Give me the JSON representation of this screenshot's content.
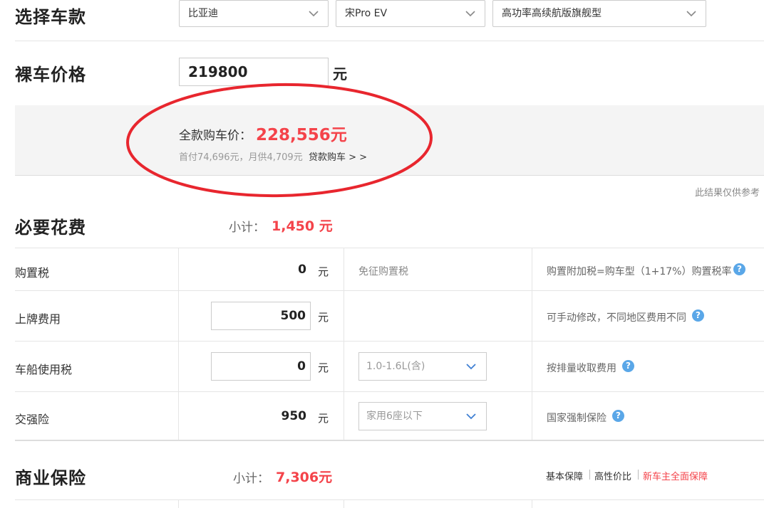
{
  "select_car": {
    "title": "选择车款",
    "brand": "比亚迪",
    "series": "宋Pro EV",
    "model": "高功率高续航版旗舰型"
  },
  "bare_price": {
    "title": "裸车价格",
    "value": "219800",
    "unit": "元"
  },
  "summary": {
    "full_label": "全款购车价：",
    "full_value": "228,556元",
    "loan_text": "首付74,696元，月供4,709元",
    "loan_link": "贷款购车 > >",
    "disclaimer": "此结果仅供参考"
  },
  "required": {
    "title": "必要花费",
    "subtotal_label": "小计：",
    "subtotal_value": "1,450 元",
    "rows": [
      {
        "label": "购置税",
        "value": "0",
        "unit": "元",
        "middle": "免征购置税",
        "note": "购置附加税=购车型（1+17%）购置税率"
      },
      {
        "label": "上牌费用",
        "value": "500",
        "unit": "元",
        "middle": "",
        "note": "可手动修改，不同地区费用不同"
      },
      {
        "label": "车船使用税",
        "value": "0",
        "unit": "元",
        "middle": "1.0-1.6L(含)",
        "note": "按排量收取费用"
      },
      {
        "label": "交强险",
        "value": "950",
        "unit": "元",
        "middle": "家用6座以下",
        "note": "国家强制保险"
      }
    ]
  },
  "commercial": {
    "title": "商业保险",
    "subtotal_label": "小计：",
    "subtotal_value": "7,306元",
    "links": [
      "基本保障",
      "高性价比",
      "新车主全面保障"
    ]
  },
  "colors": {
    "accent_red": "#f4434a",
    "help_blue": "#5aa7e8",
    "annotation_red": "#e8262e"
  }
}
